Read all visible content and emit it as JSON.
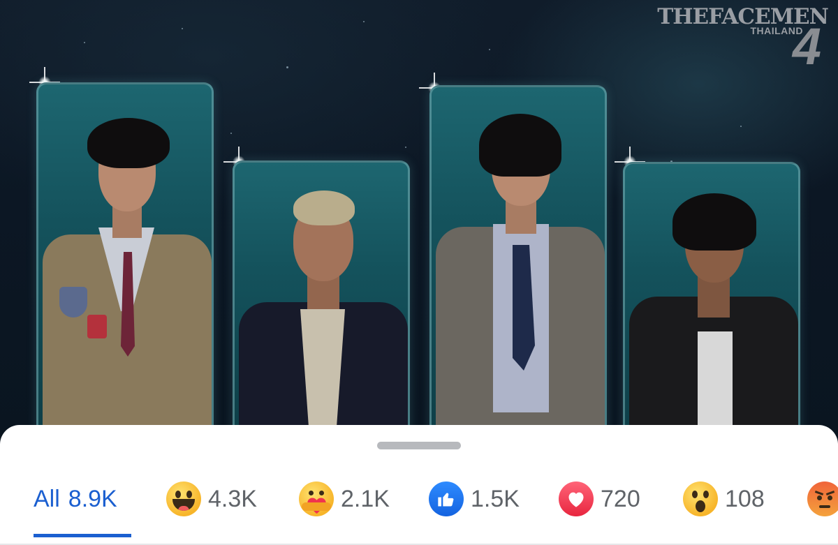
{
  "photo": {
    "brand_main": "THEFACEMEN",
    "brand_sub": "THAILAND",
    "brand_num": "4"
  },
  "reactions_sheet": {
    "all_tab": {
      "label": "All",
      "count": "8.9K"
    },
    "reactions": [
      {
        "icon": "haha-emoji-icon",
        "count": "4.3K"
      },
      {
        "icon": "care-emoji-icon",
        "count": "2.1K"
      },
      {
        "icon": "like-icon",
        "count": "1.5K"
      },
      {
        "icon": "love-heart-icon",
        "count": "720"
      },
      {
        "icon": "wow-emoji-icon",
        "count": "108"
      },
      {
        "icon": "angry-emoji-icon",
        "count": ""
      }
    ]
  },
  "colors": {
    "accent": "#1b5fd0",
    "text_muted": "#5f6368",
    "sheet_bg": "#ffffff"
  }
}
